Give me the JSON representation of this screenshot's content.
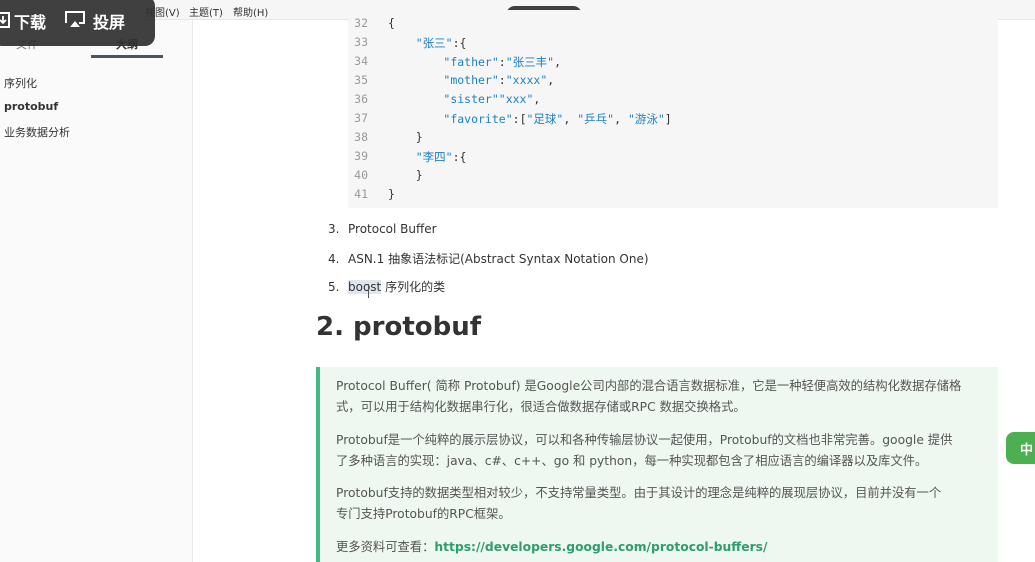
{
  "menubar": {
    "items": [
      "视图(V)",
      "主题(T)",
      "帮助(H)"
    ]
  },
  "sidebar": {
    "tabs": [
      "文件",
      "大纲"
    ],
    "outline": [
      "序列化",
      "protobuf",
      "业务数据分析"
    ]
  },
  "overlay": {
    "download_label": "下载",
    "cast_label": "投屏"
  },
  "code": {
    "lines": [
      {
        "n": "32",
        "text": "{"
      },
      {
        "n": "33",
        "text": "    \"张三\":{"
      },
      {
        "n": "34",
        "text": "        \"father\":\"张三丰\","
      },
      {
        "n": "35",
        "text": "        \"mother\":\"xxxx\","
      },
      {
        "n": "36",
        "text": "        \"sister\"\"xxx\","
      },
      {
        "n": "37",
        "text": "        \"favorite\":[\"足球\", \"乒乓\", \"游泳\"]"
      },
      {
        "n": "38",
        "text": "    }"
      },
      {
        "n": "39",
        "text": "    \"李四\":{"
      },
      {
        "n": "40",
        "text": "    }"
      },
      {
        "n": "41",
        "text": "}"
      }
    ]
  },
  "list": [
    {
      "num": "3.",
      "text": "Protocol Buffer"
    },
    {
      "num": "4.",
      "text": "ASN.1 抽象语法标记(Abstract Syntax Notation One)"
    },
    {
      "num": "5.",
      "hl": "boost",
      "text": " 序列化的类"
    }
  ],
  "heading": "2. protobuf",
  "quote": {
    "p1a": "Protocol Buffer( 简称 Protobuf) 是Google公司内部的混合语言数据标准，它是一种轻便高效的结构化数据存储格",
    "p1b": "式，可以用于结构化数据串行化，很适合做数据存储或RPC 数据交换格式。",
    "p2a": "Protobuf是一个纯粹的展示层协议，可以和各种传输层协议一起使用，Protobuf的文档也非常完善。google 提供",
    "p2b": "了多种语言的实现：java、c#、c++、go 和 python，每一种实现都包含了相应语言的编译器以及库文件。",
    "p3a": "Protobuf支持的数据类型相对较少，不支持常量类型。由于其设计的理念是纯粹的展现层协议，目前并没有一个",
    "p3b": "专门支持Protobuf的RPC框架。",
    "more_label": "更多资料可查看：",
    "link": "https://developers.google.com/protocol-buffers/"
  },
  "side_tab_label": "中",
  "colors": {
    "accent_green": "#42b983",
    "code_string": "#1e7fc3",
    "quote_bg": "#eef7f0"
  }
}
